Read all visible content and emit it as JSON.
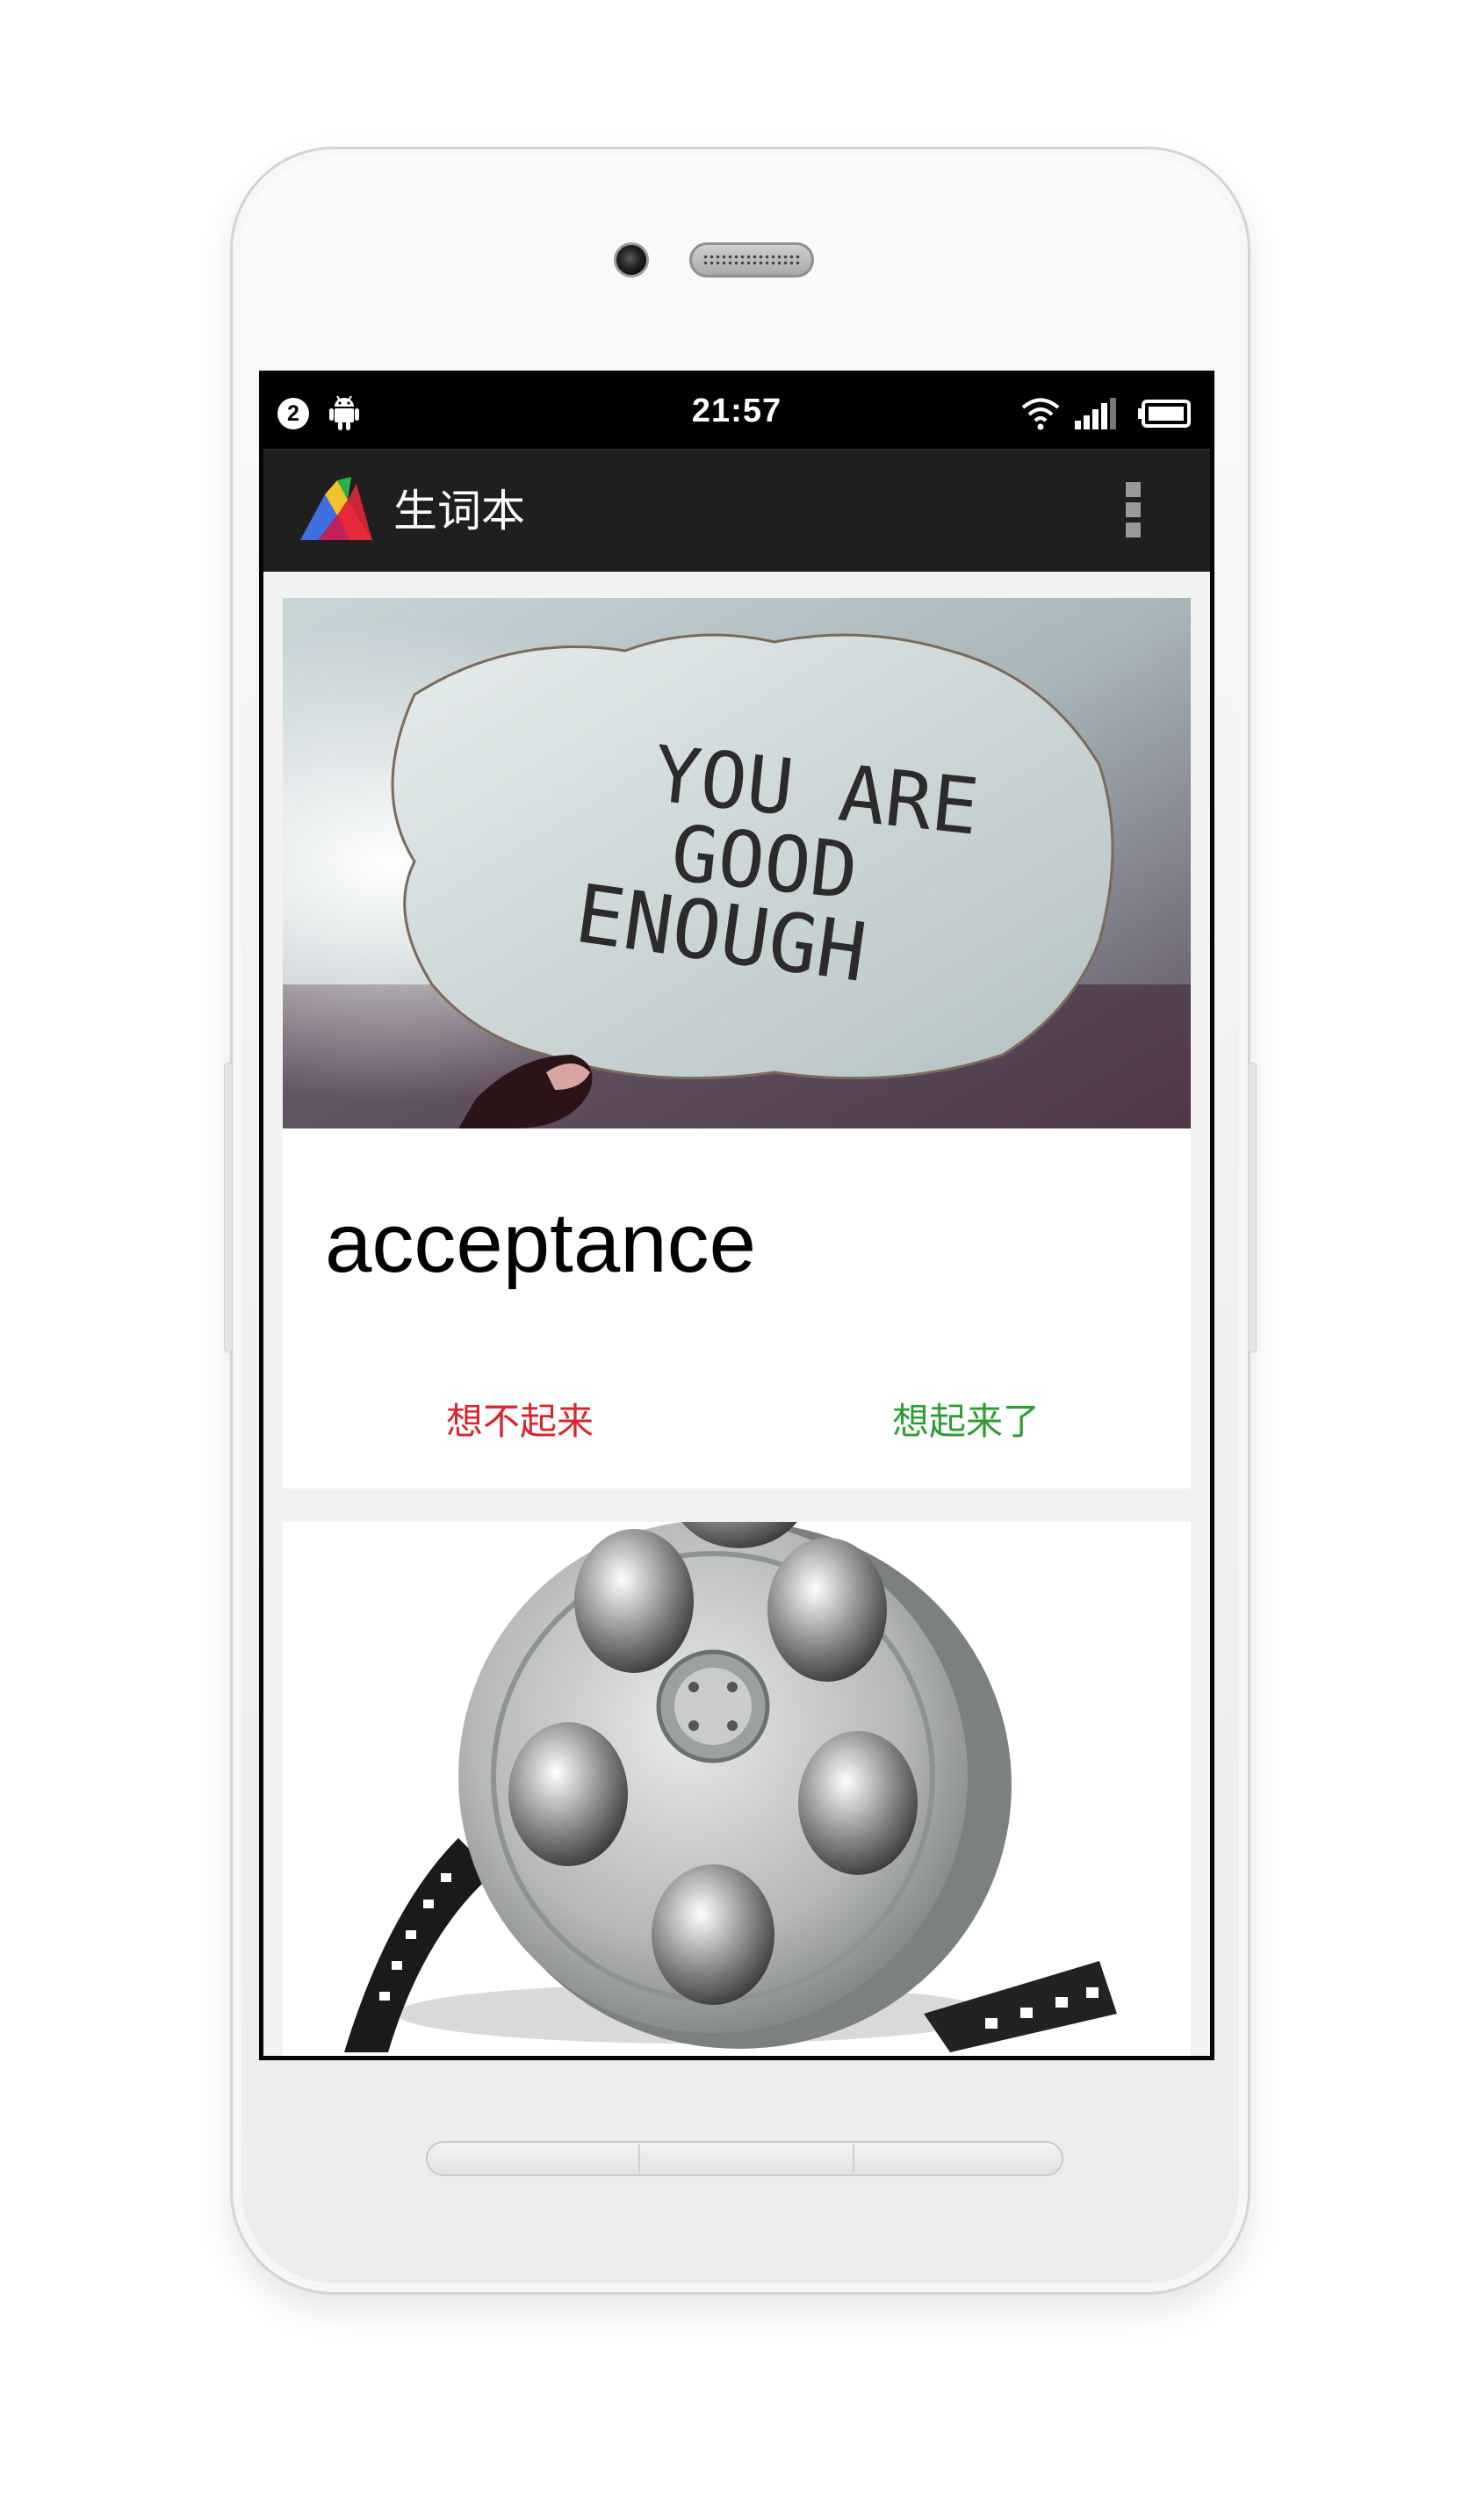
{
  "statusbar": {
    "notification_count": "2",
    "time": "21:57"
  },
  "appbar": {
    "title": "生词本"
  },
  "cards": [
    {
      "image_icon": "note-photo-icon",
      "image_text": [
        "YOU ARE",
        "GOOD",
        "ENOUGH"
      ],
      "word": "acceptance",
      "forgot_label": "想不起来",
      "remembered_label": "想起来了"
    },
    {
      "image_icon": "film-reel-icon"
    }
  ],
  "colors": {
    "forgot": "#d9262e",
    "remembered": "#2f9c35",
    "appbar": "#1f1f1f"
  }
}
